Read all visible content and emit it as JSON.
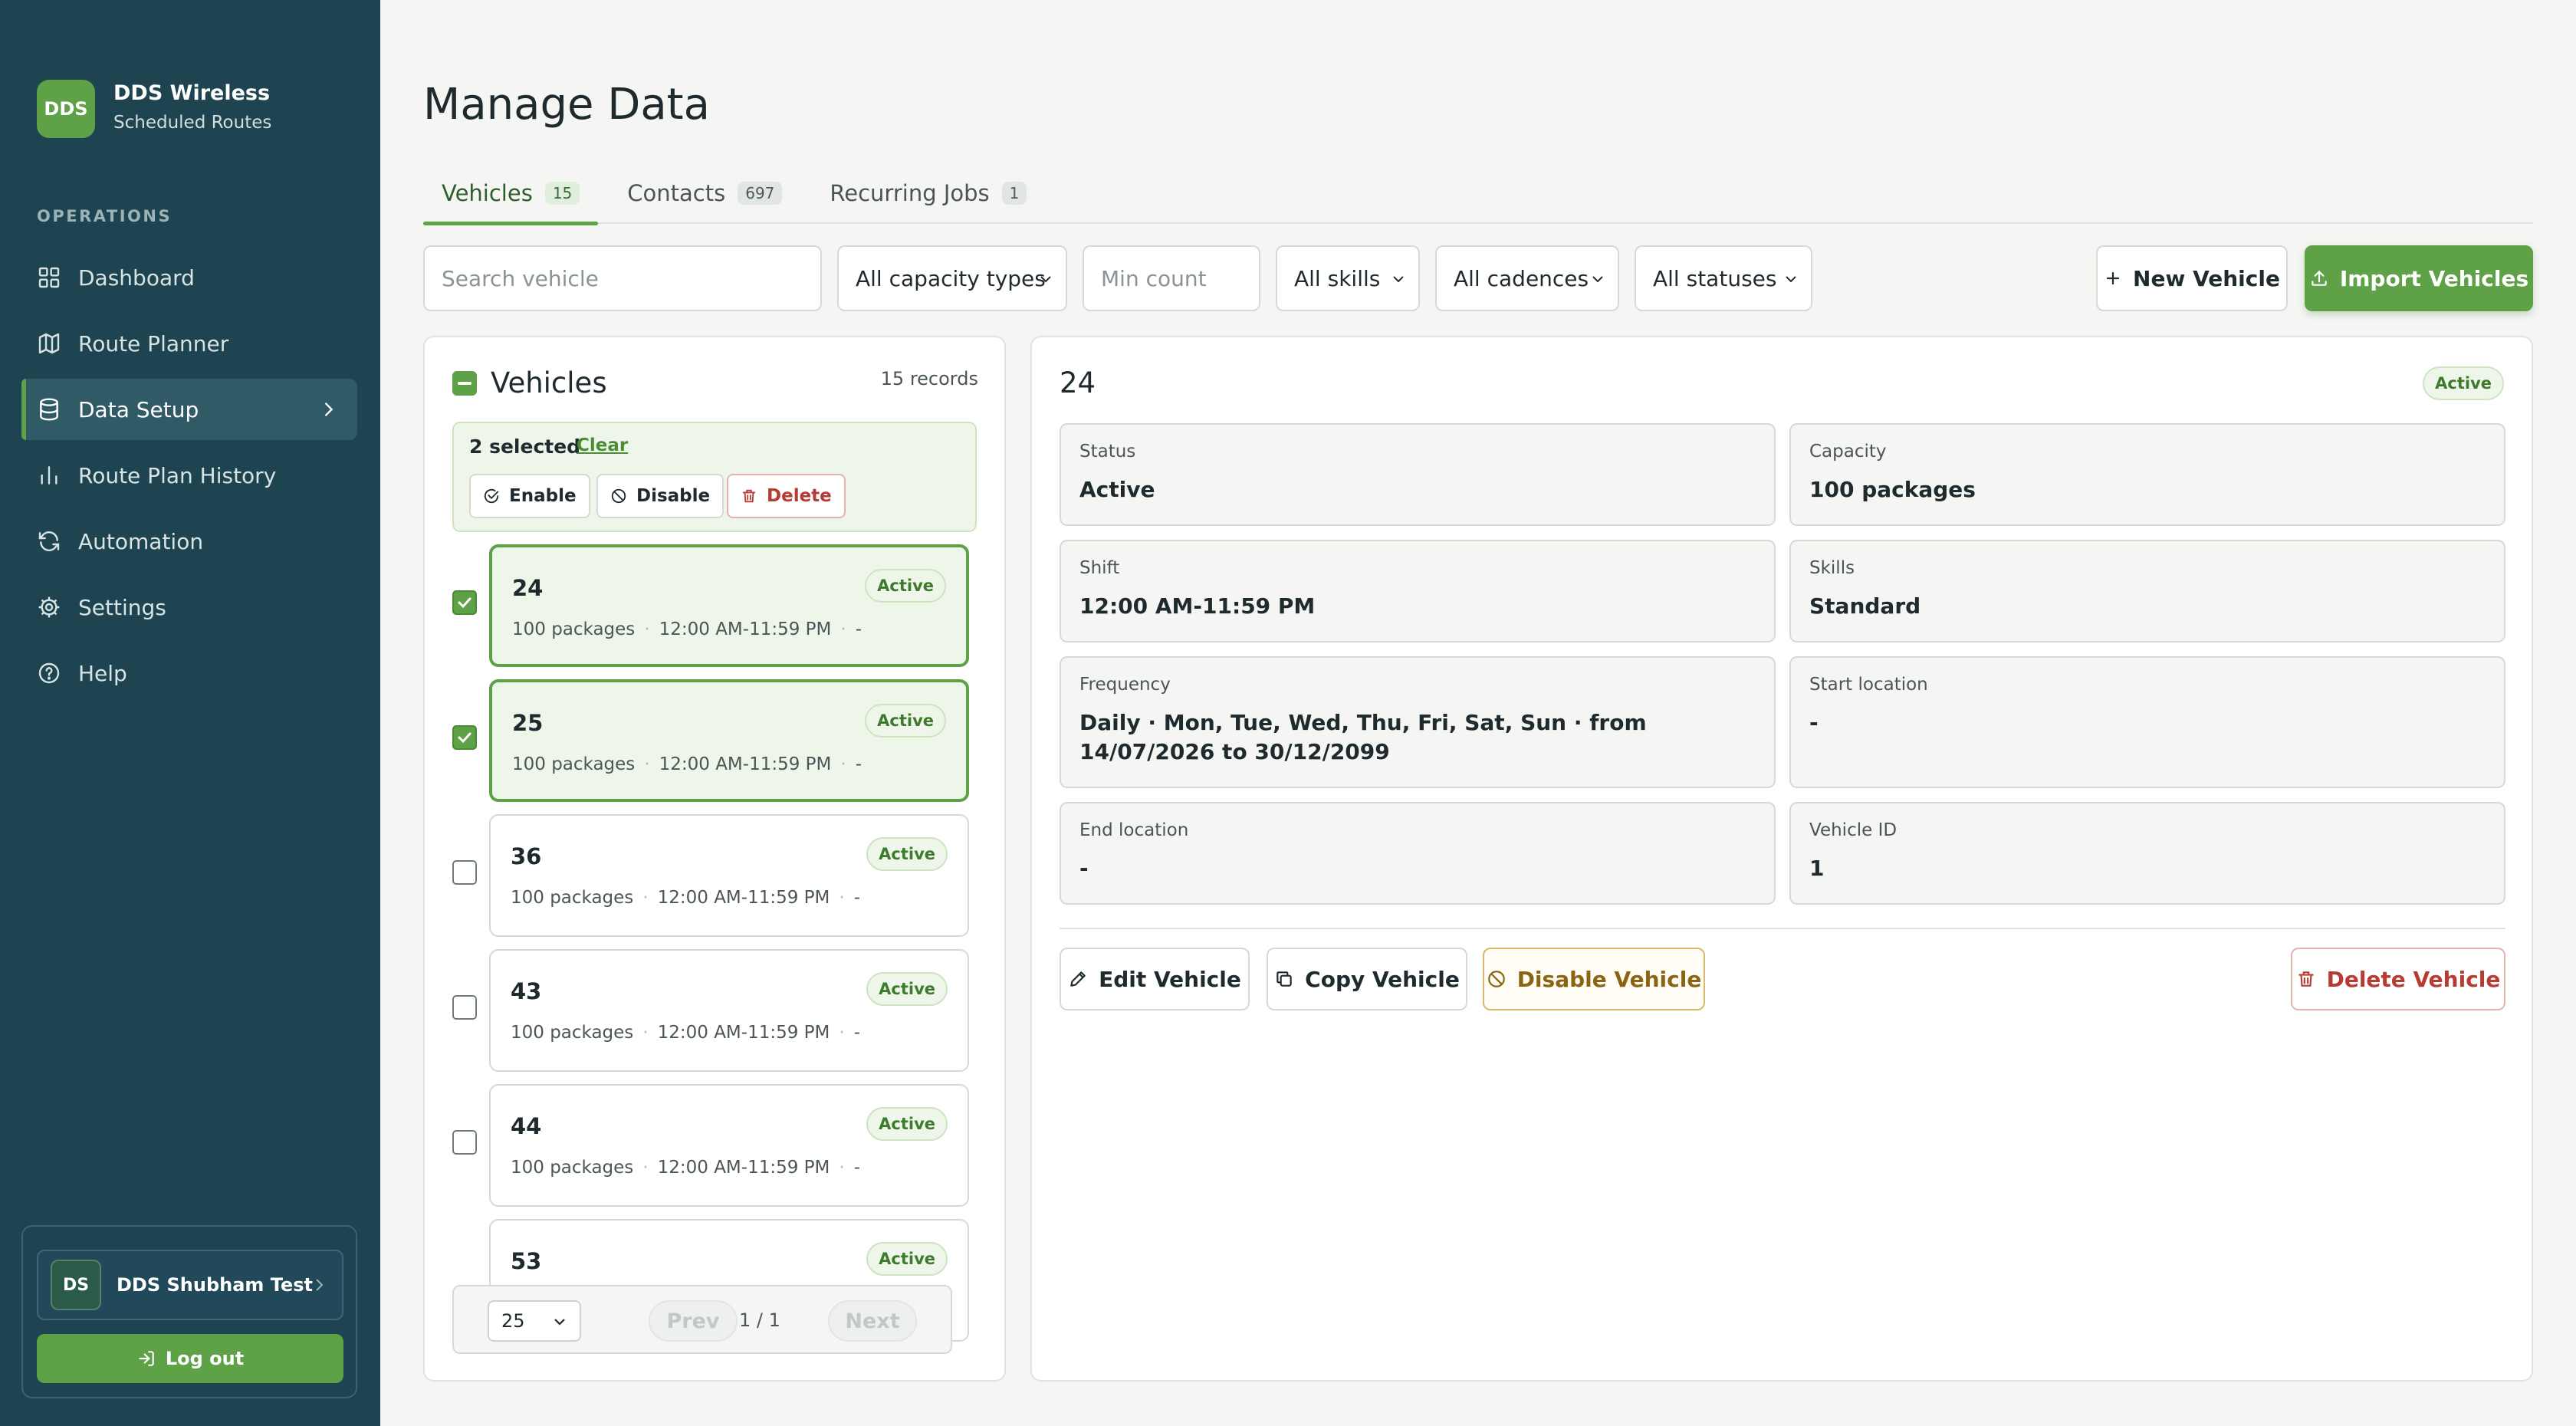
{
  "brand": {
    "logo": "DDS",
    "name": "DDS Wireless",
    "subtitle": "Scheduled Routes"
  },
  "sidebar": {
    "section_label": "OPERATIONS",
    "items": [
      {
        "label": "Dashboard",
        "icon": "grid-icon"
      },
      {
        "label": "Route Planner",
        "icon": "map-icon"
      },
      {
        "label": "Data Setup",
        "icon": "database-icon",
        "active": true
      },
      {
        "label": "Route Plan History",
        "icon": "bar-chart-icon"
      },
      {
        "label": "Automation",
        "icon": "refresh-icon"
      },
      {
        "label": "Settings",
        "icon": "gear-icon"
      },
      {
        "label": "Help",
        "icon": "help-icon"
      }
    ],
    "user": {
      "initials": "DS",
      "name": "DDS Shubham Test"
    },
    "logout_label": "Log out"
  },
  "page": {
    "title": "Manage Data"
  },
  "tabs": [
    {
      "label": "Vehicles",
      "count": "15",
      "active": true
    },
    {
      "label": "Contacts",
      "count": "697"
    },
    {
      "label": "Recurring Jobs",
      "count": "1"
    }
  ],
  "filters": {
    "search_placeholder": "Search vehicle",
    "capacity_type": "All capacity types",
    "min_count_placeholder": "Min count",
    "skills": "All skills",
    "cadences": "All cadences",
    "statuses": "All statuses",
    "new_label": "New Vehicle",
    "import_label": "Import Vehicles"
  },
  "list": {
    "title": "Vehicles",
    "records": "15 records",
    "bulk": {
      "selected": "2 selected",
      "clear": "Clear",
      "enable": "Enable",
      "disable": "Disable",
      "delete": "Delete"
    },
    "vehicles": [
      {
        "name": "24",
        "capacity": "100 packages",
        "shift": "12:00 AM-11:59 PM",
        "extra": "-",
        "status": "Active",
        "checked": true,
        "selected": true
      },
      {
        "name": "25",
        "capacity": "100 packages",
        "shift": "12:00 AM-11:59 PM",
        "extra": "-",
        "status": "Active",
        "checked": true,
        "selected": true
      },
      {
        "name": "36",
        "capacity": "100 packages",
        "shift": "12:00 AM-11:59 PM",
        "extra": "-",
        "status": "Active",
        "checked": false,
        "selected": false
      },
      {
        "name": "43",
        "capacity": "100 packages",
        "shift": "12:00 AM-11:59 PM",
        "extra": "-",
        "status": "Active",
        "checked": false,
        "selected": false
      },
      {
        "name": "44",
        "capacity": "100 packages",
        "shift": "12:00 AM-11:59 PM",
        "extra": "-",
        "status": "Active",
        "checked": false,
        "selected": false
      },
      {
        "name": "53",
        "status": "Active"
      }
    ],
    "pager": {
      "page_size": "25",
      "prev": "Prev",
      "info": "1 / 1",
      "next": "Next"
    }
  },
  "detail": {
    "title": "24",
    "status_badge": "Active",
    "fields": [
      {
        "label": "Status",
        "value": "Active"
      },
      {
        "label": "Capacity",
        "value": "100 packages"
      },
      {
        "label": "Shift",
        "value": "12:00 AM-11:59 PM"
      },
      {
        "label": "Skills",
        "value": "Standard"
      },
      {
        "label": "Frequency",
        "value": "Daily · Mon, Tue, Wed, Thu, Fri, Sat, Sun · from 14/07/2026 to 30/12/2099"
      },
      {
        "label": "Start location",
        "value": "-"
      },
      {
        "label": "End location",
        "value": "-"
      },
      {
        "label": "Vehicle ID",
        "value": "1"
      }
    ],
    "actions": {
      "edit": "Edit Vehicle",
      "copy": "Copy Vehicle",
      "disable": "Disable Vehicle",
      "delete": "Delete Vehicle"
    }
  },
  "colors": {
    "sidebar": "#1d4450",
    "accent": "#5ea146",
    "danger": "#b73a33",
    "warning": "#8b6412"
  }
}
